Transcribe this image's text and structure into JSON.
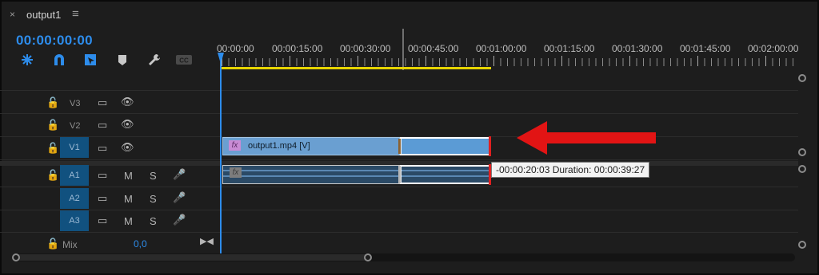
{
  "panel": {
    "close_glyph": "×",
    "title": "output1",
    "menu_glyph": "≡"
  },
  "timecode": "00:00:00:00",
  "tools": [
    {
      "name": "snap-insert-icon",
      "glyph": "✱"
    },
    {
      "name": "magnet-snap-icon",
      "glyph": "∩"
    },
    {
      "name": "linked-selection-icon",
      "glyph": "⬛"
    },
    {
      "name": "add-marker-icon",
      "glyph": "⬟"
    },
    {
      "name": "wrench-settings-icon",
      "glyph": "🔧"
    },
    {
      "name": "captions-icon",
      "glyph": "CC"
    }
  ],
  "ruler_labels": [
    "00:00:00",
    "00:00:15:00",
    "00:00:30:00",
    "00:00:45:00",
    "00:01:00:00",
    "00:01:15:00",
    "00:01:30:00",
    "00:01:45:00",
    "00:02:00:00"
  ],
  "tracks": {
    "video": [
      {
        "id": "V3",
        "lock": "🔓",
        "sync": "▭",
        "eye": "👁"
      },
      {
        "id": "V2",
        "lock": "🔓",
        "sync": "▭",
        "eye": "👁"
      },
      {
        "id": "V1",
        "lock": "🔓",
        "sync": "▭",
        "eye": "👁"
      }
    ],
    "audio": [
      {
        "id": "A1",
        "mute": "M",
        "solo": "S",
        "mic": "🎤"
      },
      {
        "id": "A2",
        "mute": "M",
        "solo": "S",
        "mic": "🎤"
      },
      {
        "id": "A3",
        "mute": "M",
        "solo": "S",
        "mic": "🎤"
      }
    ],
    "mix": {
      "label": "Mix",
      "value": "0,0"
    }
  },
  "clips": {
    "video_clip_name": "output1.mp4 [V]",
    "fx_label": "fx"
  },
  "tooltip": "-00:00:20:03 Duration: 00:00:39:27",
  "colors": {
    "accent": "#2d8ceb",
    "workarea": "#e6d400",
    "arrow": "#e21414"
  }
}
